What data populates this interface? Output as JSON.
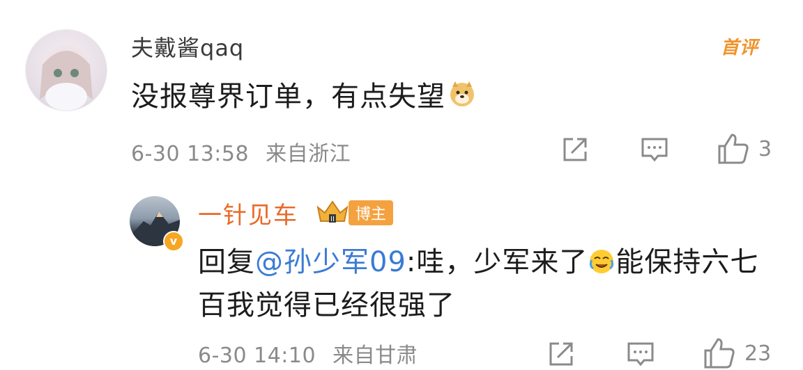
{
  "comment": {
    "username": "夫戴酱qaq",
    "pinned_label": "首评",
    "text": "没报尊界订单，有点失望",
    "emoji": "doge-emoji",
    "date": "6-30 13:58",
    "location": "来自浙江",
    "like_count": "3"
  },
  "reply": {
    "username": "一针见车",
    "badge_label": "博主",
    "prefix": "回复",
    "mention": "@孙少军09",
    "text_before_emoji": ":哇，少军来了",
    "emoji": "cry-laugh-emoji",
    "text_after_emoji": "能保持六七百我觉得已经很强了",
    "verify_mark": "v",
    "date": "6-30 14:10",
    "location": "来自甘肃",
    "like_count": "23"
  },
  "colors": {
    "username_reply": "#e86a27",
    "mention": "#3a7bd5",
    "pinned": "#f0932b",
    "meta": "#8a8a8a"
  }
}
